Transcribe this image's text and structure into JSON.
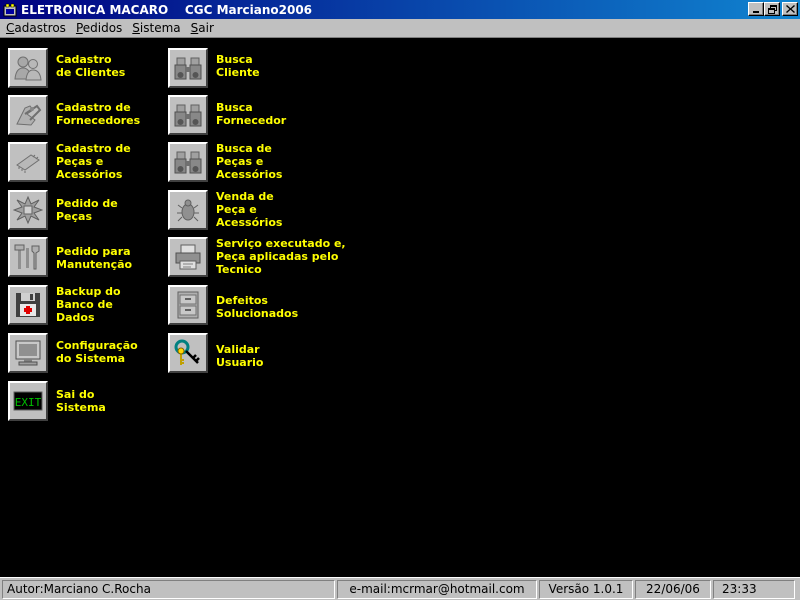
{
  "window": {
    "title": "ELETRONICA MACARO    CGC Marciano2006",
    "minimize_label": "_",
    "restore_label": "❐",
    "close_label": "✕"
  },
  "menu": {
    "items": [
      {
        "accel": "C",
        "rest": "adastros"
      },
      {
        "accel": "P",
        "rest": "edidos"
      },
      {
        "accel": "S",
        "rest": "istema"
      },
      {
        "accel": "S",
        "rest": "air"
      }
    ]
  },
  "left_tiles": [
    {
      "icon": "people-icon",
      "label": "Cadastro\nde Clientes"
    },
    {
      "icon": "handshake-icon",
      "label": "Cadastro de\nFornecedores"
    },
    {
      "icon": "chip-icon",
      "label": "Cadastro de\nPeças e\nAcessórios"
    },
    {
      "icon": "burst-icon",
      "label": "Pedido de\nPeças"
    },
    {
      "icon": "tools-icon",
      "label": "Pedido para\nManutenção"
    },
    {
      "icon": "floppy-icon",
      "label": "Backup do\nBanco de\nDados"
    },
    {
      "icon": "monitor-icon",
      "label": "Configuração\ndo Sistema"
    },
    {
      "icon": "exit-icon",
      "label": "Sai do\nSistema"
    }
  ],
  "right_tiles": [
    {
      "icon": "binoculars-icon",
      "label": "Busca\nCliente"
    },
    {
      "icon": "binoculars-icon",
      "label": "Busca\nFornecedor"
    },
    {
      "icon": "binoculars-icon",
      "label": "Busca de\nPeças e\nAcessórios"
    },
    {
      "icon": "bug-icon",
      "label": "Venda de\nPeça e\nAcessórios"
    },
    {
      "icon": "printer-icon",
      "label": "Serviço executado e,\nPeça aplicadas pelo\nTecnico"
    },
    {
      "icon": "cabinet-icon",
      "label": "Defeitos\nSolucionados"
    },
    {
      "icon": "keys-icon",
      "label": "Validar\nUsuario"
    }
  ],
  "exit_icon_text": "EXIT",
  "status": {
    "author": "Autor:Marciano C.Rocha",
    "email": "e-mail:mcrmar@hotmail.com",
    "version": "Versão 1.0.1",
    "date": "22/06/06",
    "time": "23:33"
  },
  "colors": {
    "label": "#ffff00",
    "background": "#000000",
    "chrome": "#c0c0c0",
    "titlebar": "#000080"
  }
}
